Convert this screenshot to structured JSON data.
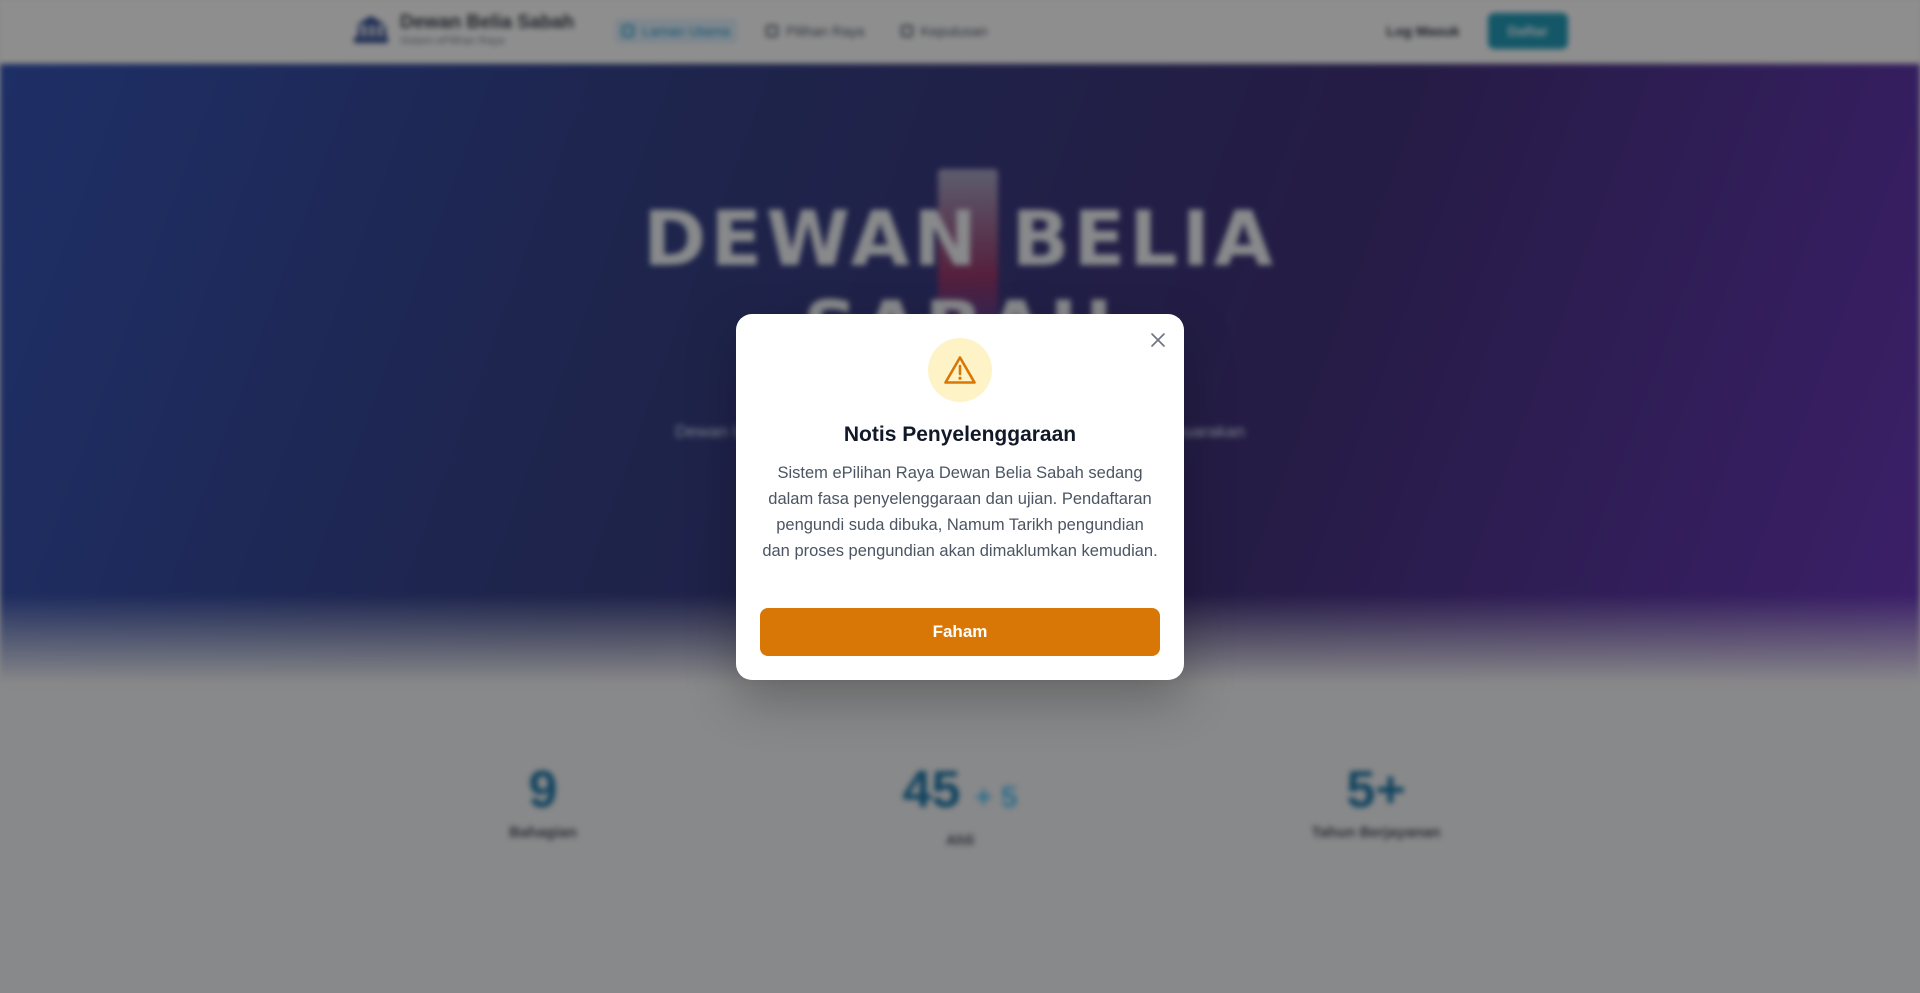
{
  "navbar": {
    "brand_title": "Dewan Belia Sabah",
    "brand_subtitle": "Sistem ePilihan Raya",
    "links": [
      {
        "label": "Laman Utama",
        "active": true
      },
      {
        "label": "Pilihan Raya",
        "active": false
      },
      {
        "label": "Keputusan",
        "active": false
      }
    ],
    "login_link": "Log Masuk",
    "login_button": "Daftar"
  },
  "hero": {
    "title_line1": "DEWAN BELIA",
    "title_line2": "SABAH",
    "description": "Dewan Undangan Belia Sabah, platform untuk belia bersuara menyuarakan"
  },
  "stats": [
    {
      "value": "9",
      "suffix": "",
      "label": "Bahagian"
    },
    {
      "value": "45",
      "suffix": "+ 5",
      "label": "Ahli"
    },
    {
      "value": "5+",
      "suffix": "",
      "label": "Tahun Berjayanan"
    }
  ],
  "modal": {
    "title": "Notis Penyelenggaraan",
    "body": "Sistem ePilihan Raya Dewan Belia Sabah sedang dalam fasa penyelenggaraan dan ujian. Pendaftaran pengundi suda dibuka, Namum Tarikh pengundian dan proses pengundian akan dimaklumkan kemudian.",
    "confirm_label": "Faham",
    "icons": {
      "close": "close-icon",
      "warning": "warning-triangle-icon"
    }
  },
  "colors": {
    "accent": "#d97706",
    "warning_bg": "#fef3c7",
    "primary": "#0891b2"
  }
}
